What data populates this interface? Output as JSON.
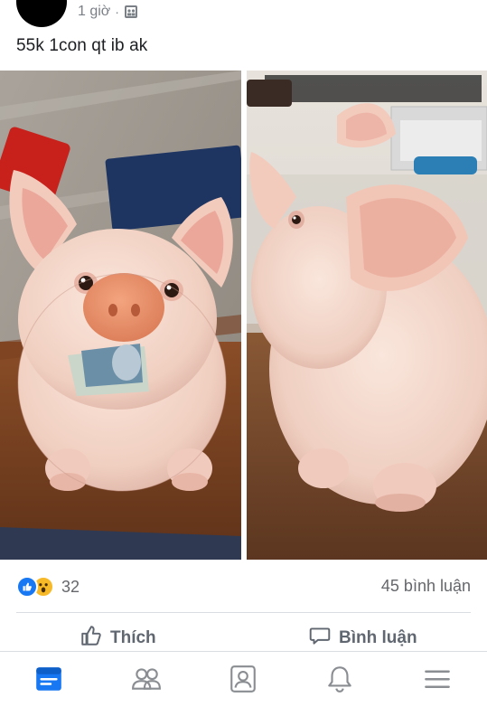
{
  "post": {
    "time": "1 giờ",
    "separator": "·",
    "audience_icon": "group-audience-icon",
    "caption": "55k 1con qt ib ak"
  },
  "photos": [
    {
      "name": "piggy-bank-front-photo",
      "description_icon": "image"
    },
    {
      "name": "piggy-bank-side-photo",
      "description_icon": "image"
    }
  ],
  "reactions": {
    "types": [
      "like",
      "wow"
    ],
    "count": "32",
    "comments": "45 bình luận"
  },
  "actions": {
    "like_label": "Thích",
    "comment_label": "Bình luận"
  },
  "tabbar": {
    "items": [
      "news-feed-icon",
      "friends-icon",
      "profile-icon",
      "notifications-icon",
      "menu-icon"
    ],
    "active": "news-feed-icon",
    "active_color": "#1877f2",
    "inactive_color": "#8a8d91"
  }
}
